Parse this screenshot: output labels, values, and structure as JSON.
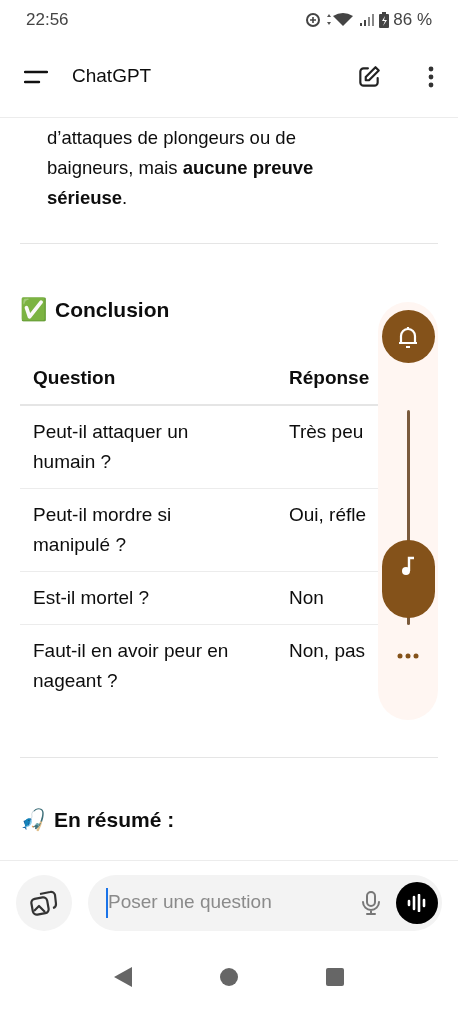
{
  "status_bar": {
    "time": "22:56",
    "battery": "86 %"
  },
  "app_bar": {
    "title": "ChatGPT"
  },
  "message": {
    "paragraph": "d’attaques de plongeurs ou de baigneurs, mais **aucune preuve sérieuse**.",
    "heading": "Conclusion",
    "heading_emoji": "✅",
    "table": {
      "columns": [
        "Question",
        "Réponse"
      ],
      "rows": [
        [
          "Peut-il attaquer un humain ?",
          "Très peu"
        ],
        [
          "Peut-il mordre si manipulé ?",
          "Oui, réfle"
        ],
        [
          "Est-il mortel ?",
          "Non"
        ],
        [
          "Faut-il en avoir peur en nageant ?",
          "Non, pas"
        ]
      ]
    },
    "summary_heading": "En résumé :",
    "summary_emoji": "🎣"
  },
  "volume_panel": {
    "level": 0.05
  },
  "composer": {
    "placeholder": "Poser une question",
    "focused": true
  }
}
